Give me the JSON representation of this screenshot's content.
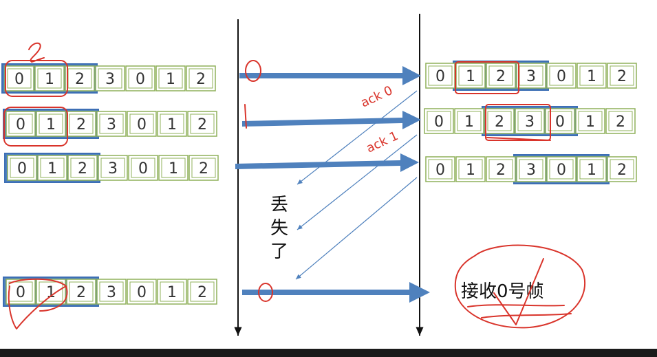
{
  "colors": {
    "cell_border": "#8fb05a",
    "window_border": "#3d6fb5",
    "window_fill": "#4f81bd",
    "arrow": "#4f81bd",
    "annotation": "#d9342b",
    "timeline": "#111111"
  },
  "sender_rows": [
    {
      "cells": [
        "0",
        "1",
        "2",
        "3",
        "0",
        "1",
        "2"
      ],
      "window": [
        0,
        2
      ],
      "marks": [
        "circle-0-1",
        "scribble-2"
      ]
    },
    {
      "cells": [
        "0",
        "1",
        "2",
        "3",
        "0",
        "1",
        "2"
      ],
      "window": [
        0,
        2
      ],
      "marks": [
        "circle-0-1"
      ]
    },
    {
      "cells": [
        "0",
        "1",
        "2",
        "3",
        "0",
        "1",
        "2"
      ],
      "window": [
        0,
        2
      ],
      "marks": []
    },
    {
      "cells": [
        "0",
        "1",
        "2",
        "3",
        "0",
        "1",
        "2"
      ],
      "window": [
        0,
        2
      ],
      "marks": [
        "check-0-1"
      ]
    }
  ],
  "receiver_rows": [
    {
      "cells": [
        "0",
        "1",
        "2",
        "3",
        "0",
        "1",
        "2"
      ],
      "window": [
        1,
        3
      ],
      "marks": [
        "box-1-2"
      ]
    },
    {
      "cells": [
        "0",
        "1",
        "2",
        "3",
        "0",
        "1",
        "2"
      ],
      "window": [
        2,
        4
      ],
      "marks": [
        "box-2-3"
      ]
    },
    {
      "cells": [
        "0",
        "1",
        "2",
        "3",
        "0",
        "1",
        "2"
      ],
      "window": [
        3,
        5
      ],
      "marks": []
    }
  ],
  "frame_arrows": [
    {
      "label": "0"
    },
    {
      "label": "1"
    },
    {
      "label": ""
    },
    {
      "label": "0"
    }
  ],
  "ack_labels": [
    "ack 0",
    "ack 1"
  ],
  "lost_note": [
    "丢",
    "失",
    "了"
  ],
  "result_note": "接收0号帧"
}
